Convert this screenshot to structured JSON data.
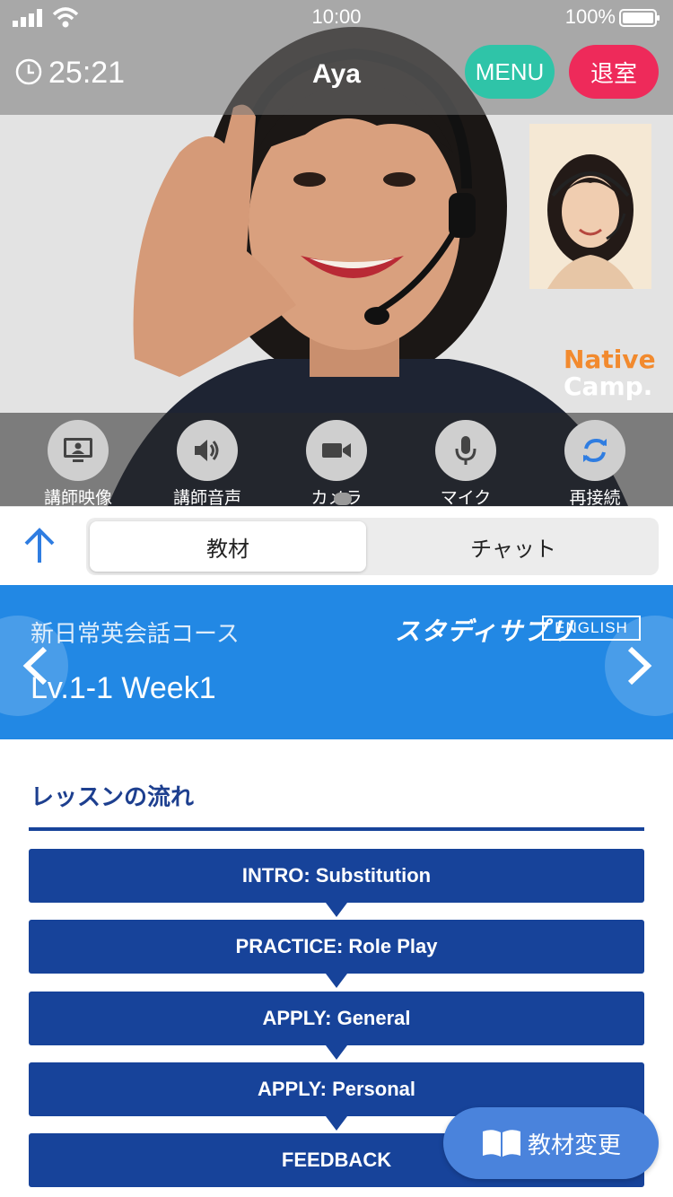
{
  "status_bar": {
    "time": "10:00",
    "battery": "100%"
  },
  "session": {
    "timer": "25:21",
    "teacher_name": "Aya",
    "menu_label": "MENU",
    "exit_label": "退室"
  },
  "brand": {
    "line1": "Native",
    "line2": "Camp."
  },
  "controls": [
    {
      "label": "講師映像",
      "icon": "monitor-icon"
    },
    {
      "label": "講師音声",
      "icon": "speaker-icon"
    },
    {
      "label": "カメラ",
      "icon": "camera-icon"
    },
    {
      "label": "マイク",
      "icon": "microphone-icon"
    },
    {
      "label": "再接続",
      "icon": "reconnect-icon"
    }
  ],
  "tabs": {
    "active": "教材",
    "inactive": "チャット"
  },
  "course": {
    "name": "新日常英会話コース",
    "level": "Lv.1-1 Week1",
    "publisher": "スタディサプリ",
    "badge": "ENGLISH"
  },
  "lesson_flow": {
    "title": "レッスンの流れ",
    "steps": [
      "INTRO: Substitution",
      "PRACTICE: Role Play",
      "APPLY: General",
      "APPLY: Personal",
      "FEEDBACK"
    ]
  },
  "change_material_label": "教材変更",
  "colors": {
    "menu": "#2fc4a8",
    "exit": "#ee2a5a",
    "course_header": "#2288e4",
    "flow_step": "#17439a",
    "change_button": "#4a83dc"
  }
}
